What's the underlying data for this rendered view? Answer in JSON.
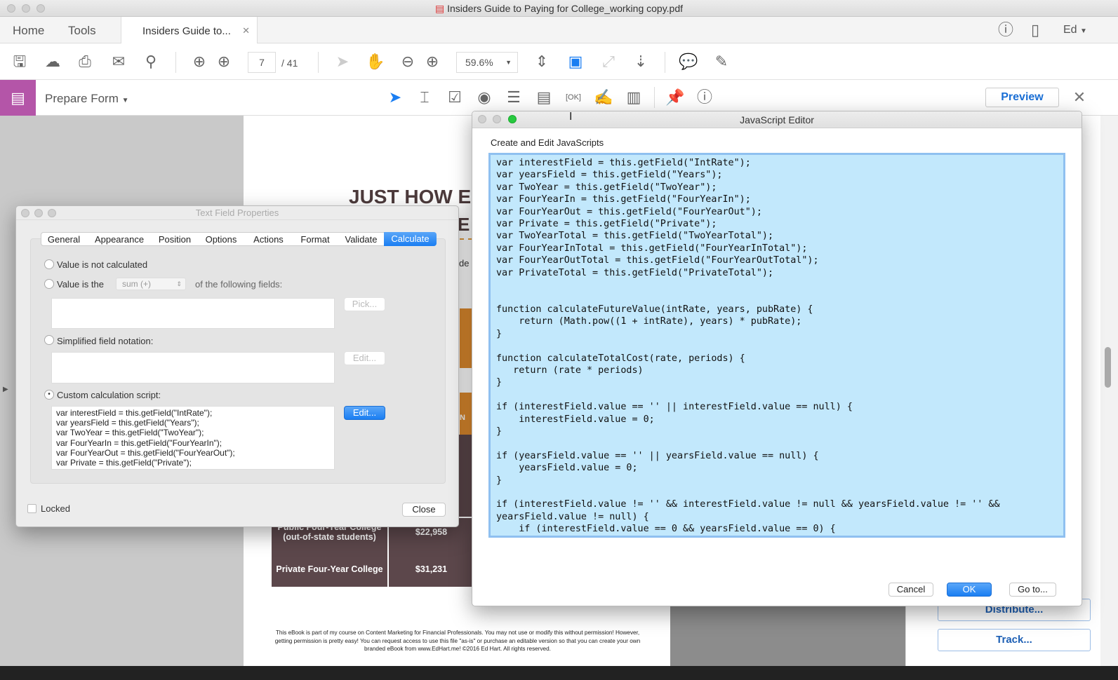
{
  "window": {
    "title": "Insiders Guide to Paying for College_working copy.pdf"
  },
  "nav": {
    "home": "Home",
    "tools": "Tools",
    "doc_tab": "Insiders Guide to...",
    "user": "Ed"
  },
  "toolbar": {
    "page_current": "7",
    "page_total": "/ 41",
    "zoom": "59.6%"
  },
  "formbar": {
    "title": "Prepare Form",
    "preview": "Preview"
  },
  "pdf": {
    "heading": "JUST HOW E",
    "heading2": "E",
    "partial": "de",
    "partial2": "N",
    "rows": [
      {
        "label": "Public Four-Year College (out-of-state students)",
        "value": "$22,958"
      },
      {
        "label": "Private Four-Year College",
        "value": "$31,231"
      }
    ],
    "footer": "This eBook is part of my course on Content Marketing for Financial Professionals. You may not use or modify this without permission!  However, getting permission is pretty easy!  You can request access to use this file \"as-is\" or purchase an editable version so that you can create your own branded eBook from www.EdHart.me!  ©2016 Ed Hart.  All rights reserved."
  },
  "right_panel": {
    "distribute": "Distribute...",
    "track": "Track..."
  },
  "tfp": {
    "title": "Text Field Properties",
    "tabs": [
      "General",
      "Appearance",
      "Position",
      "Options",
      "Actions",
      "Format",
      "Validate",
      "Calculate"
    ],
    "opt_none": "Value is not calculated",
    "opt_value": "Value is the",
    "op_select": "sum (+)",
    "following": "of the following fields:",
    "pick": "Pick...",
    "opt_simplified": "Simplified field notation:",
    "edit": "Edit...",
    "opt_custom": "Custom calculation script:",
    "script_preview": [
      "var interestField = this.getField(\"IntRate\");",
      "var yearsField = this.getField(\"Years\");",
      "var TwoYear = this.getField(\"TwoYear\");",
      "var FourYearIn = this.getField(\"FourYearIn\");",
      "var FourYearOut = this.getField(\"FourYearOut\");",
      "var Private = this.getField(\"Private\");"
    ],
    "locked": "Locked",
    "close": "Close"
  },
  "jse": {
    "title": "JavaScript Editor",
    "subtitle": "Create and Edit JavaScripts",
    "cancel": "Cancel",
    "ok": "OK",
    "goto": "Go to...",
    "code": [
      "var interestField = this.getField(\"IntRate\");",
      "var yearsField = this.getField(\"Years\");",
      "var TwoYear = this.getField(\"TwoYear\");",
      "var FourYearIn = this.getField(\"FourYearIn\");",
      "var FourYearOut = this.getField(\"FourYearOut\");",
      "var Private = this.getField(\"Private\");",
      "var TwoYearTotal = this.getField(\"TwoYearTotal\");",
      "var FourYearInTotal = this.getField(\"FourYearInTotal\");",
      "var FourYearOutTotal = this.getField(\"FourYearOutTotal\");",
      "var PrivateTotal = this.getField(\"PrivateTotal\");",
      "",
      "",
      "function calculateFutureValue(intRate, years, pubRate) {",
      "    return (Math.pow((1 + intRate), years) * pubRate);",
      "}",
      "",
      "function calculateTotalCost(rate, periods) {",
      "   return (rate * periods)",
      "}",
      "",
      "if (interestField.value == '' || interestField.value == null) {",
      "    interestField.value = 0;",
      "}",
      "",
      "if (yearsField.value == '' || yearsField.value == null) {",
      "    yearsField.value = 0;",
      "}",
      "",
      "if (interestField.value != '' && interestField.value != null && yearsField.value != '' &&",
      "yearsField.value != null) {",
      "    if (interestField.value == 0 && yearsField.value == 0) {"
    ]
  }
}
